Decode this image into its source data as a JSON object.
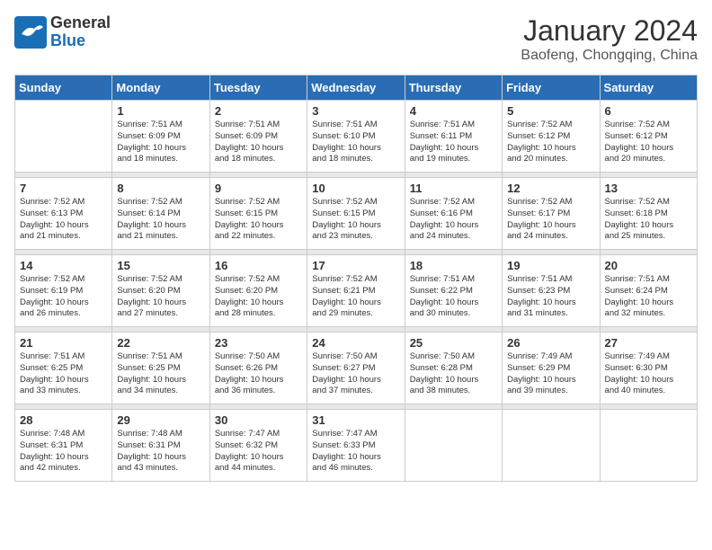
{
  "logo": {
    "general": "General",
    "blue": "Blue"
  },
  "title": "January 2024",
  "subtitle": "Baofeng, Chongqing, China",
  "days_of_week": [
    "Sunday",
    "Monday",
    "Tuesday",
    "Wednesday",
    "Thursday",
    "Friday",
    "Saturday"
  ],
  "weeks": [
    {
      "days": [
        {
          "num": "",
          "info": ""
        },
        {
          "num": "1",
          "info": "Sunrise: 7:51 AM\nSunset: 6:09 PM\nDaylight: 10 hours\nand 18 minutes."
        },
        {
          "num": "2",
          "info": "Sunrise: 7:51 AM\nSunset: 6:09 PM\nDaylight: 10 hours\nand 18 minutes."
        },
        {
          "num": "3",
          "info": "Sunrise: 7:51 AM\nSunset: 6:10 PM\nDaylight: 10 hours\nand 18 minutes."
        },
        {
          "num": "4",
          "info": "Sunrise: 7:51 AM\nSunset: 6:11 PM\nDaylight: 10 hours\nand 19 minutes."
        },
        {
          "num": "5",
          "info": "Sunrise: 7:52 AM\nSunset: 6:12 PM\nDaylight: 10 hours\nand 20 minutes."
        },
        {
          "num": "6",
          "info": "Sunrise: 7:52 AM\nSunset: 6:12 PM\nDaylight: 10 hours\nand 20 minutes."
        }
      ]
    },
    {
      "days": [
        {
          "num": "7",
          "info": "Sunrise: 7:52 AM\nSunset: 6:13 PM\nDaylight: 10 hours\nand 21 minutes."
        },
        {
          "num": "8",
          "info": "Sunrise: 7:52 AM\nSunset: 6:14 PM\nDaylight: 10 hours\nand 21 minutes."
        },
        {
          "num": "9",
          "info": "Sunrise: 7:52 AM\nSunset: 6:15 PM\nDaylight: 10 hours\nand 22 minutes."
        },
        {
          "num": "10",
          "info": "Sunrise: 7:52 AM\nSunset: 6:15 PM\nDaylight: 10 hours\nand 23 minutes."
        },
        {
          "num": "11",
          "info": "Sunrise: 7:52 AM\nSunset: 6:16 PM\nDaylight: 10 hours\nand 24 minutes."
        },
        {
          "num": "12",
          "info": "Sunrise: 7:52 AM\nSunset: 6:17 PM\nDaylight: 10 hours\nand 24 minutes."
        },
        {
          "num": "13",
          "info": "Sunrise: 7:52 AM\nSunset: 6:18 PM\nDaylight: 10 hours\nand 25 minutes."
        }
      ]
    },
    {
      "days": [
        {
          "num": "14",
          "info": "Sunrise: 7:52 AM\nSunset: 6:19 PM\nDaylight: 10 hours\nand 26 minutes."
        },
        {
          "num": "15",
          "info": "Sunrise: 7:52 AM\nSunset: 6:20 PM\nDaylight: 10 hours\nand 27 minutes."
        },
        {
          "num": "16",
          "info": "Sunrise: 7:52 AM\nSunset: 6:20 PM\nDaylight: 10 hours\nand 28 minutes."
        },
        {
          "num": "17",
          "info": "Sunrise: 7:52 AM\nSunset: 6:21 PM\nDaylight: 10 hours\nand 29 minutes."
        },
        {
          "num": "18",
          "info": "Sunrise: 7:51 AM\nSunset: 6:22 PM\nDaylight: 10 hours\nand 30 minutes."
        },
        {
          "num": "19",
          "info": "Sunrise: 7:51 AM\nSunset: 6:23 PM\nDaylight: 10 hours\nand 31 minutes."
        },
        {
          "num": "20",
          "info": "Sunrise: 7:51 AM\nSunset: 6:24 PM\nDaylight: 10 hours\nand 32 minutes."
        }
      ]
    },
    {
      "days": [
        {
          "num": "21",
          "info": "Sunrise: 7:51 AM\nSunset: 6:25 PM\nDaylight: 10 hours\nand 33 minutes."
        },
        {
          "num": "22",
          "info": "Sunrise: 7:51 AM\nSunset: 6:25 PM\nDaylight: 10 hours\nand 34 minutes."
        },
        {
          "num": "23",
          "info": "Sunrise: 7:50 AM\nSunset: 6:26 PM\nDaylight: 10 hours\nand 36 minutes."
        },
        {
          "num": "24",
          "info": "Sunrise: 7:50 AM\nSunset: 6:27 PM\nDaylight: 10 hours\nand 37 minutes."
        },
        {
          "num": "25",
          "info": "Sunrise: 7:50 AM\nSunset: 6:28 PM\nDaylight: 10 hours\nand 38 minutes."
        },
        {
          "num": "26",
          "info": "Sunrise: 7:49 AM\nSunset: 6:29 PM\nDaylight: 10 hours\nand 39 minutes."
        },
        {
          "num": "27",
          "info": "Sunrise: 7:49 AM\nSunset: 6:30 PM\nDaylight: 10 hours\nand 40 minutes."
        }
      ]
    },
    {
      "days": [
        {
          "num": "28",
          "info": "Sunrise: 7:48 AM\nSunset: 6:31 PM\nDaylight: 10 hours\nand 42 minutes."
        },
        {
          "num": "29",
          "info": "Sunrise: 7:48 AM\nSunset: 6:31 PM\nDaylight: 10 hours\nand 43 minutes."
        },
        {
          "num": "30",
          "info": "Sunrise: 7:47 AM\nSunset: 6:32 PM\nDaylight: 10 hours\nand 44 minutes."
        },
        {
          "num": "31",
          "info": "Sunrise: 7:47 AM\nSunset: 6:33 PM\nDaylight: 10 hours\nand 46 minutes."
        },
        {
          "num": "",
          "info": ""
        },
        {
          "num": "",
          "info": ""
        },
        {
          "num": "",
          "info": ""
        }
      ]
    }
  ]
}
